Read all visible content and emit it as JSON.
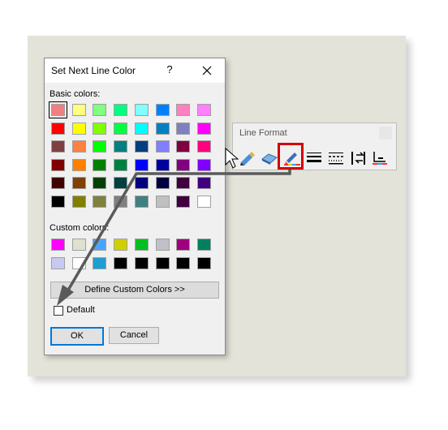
{
  "dialog": {
    "title": "Set Next Line Color",
    "help_label": "?",
    "basic_colors_label": "Basic colors:",
    "custom_colors_label": "Custom colors:",
    "define_button_label": "Define Custom Colors >>",
    "default_checkbox_label": "Default",
    "default_checked": false,
    "ok_label": "OK",
    "cancel_label": "Cancel",
    "basic_colors": [
      [
        "#f08080",
        "#ffff80",
        "#80ff80",
        "#00ff80",
        "#80ffff",
        "#0080ff",
        "#ff80c0",
        "#ff80ff"
      ],
      [
        "#ff0000",
        "#ffff00",
        "#80ff00",
        "#00ff40",
        "#00ffff",
        "#0080c0",
        "#8080c0",
        "#ff00ff"
      ],
      [
        "#804040",
        "#ff8040",
        "#00ff00",
        "#008080",
        "#004080",
        "#8080ff",
        "#800040",
        "#ff0080"
      ],
      [
        "#800000",
        "#ff8000",
        "#008000",
        "#008040",
        "#0000ff",
        "#0000a0",
        "#800080",
        "#8000ff"
      ],
      [
        "#400000",
        "#804000",
        "#004000",
        "#004040",
        "#000080",
        "#000040",
        "#400040",
        "#400080"
      ],
      [
        "#000000",
        "#808000",
        "#808040",
        "#808080",
        "#408080",
        "#c0c0c0",
        "#400040",
        "#ffffff"
      ]
    ],
    "custom_colors": [
      [
        "#ff00ff",
        "#e0e0d0",
        "#4aa3ff",
        "#d0d000",
        "#00c020",
        "#c0c0c8",
        "#a00080",
        "#008060"
      ],
      [
        "#c8c8f0",
        "#ffffff",
        "#1f9fcf",
        "#000000",
        "#000000",
        "#000000",
        "#000000",
        "#000000"
      ]
    ]
  },
  "toolbar": {
    "title": "Line Format",
    "icons": [
      "pen-icon",
      "eraser-icon",
      "line-color-icon",
      "line-weight-icon",
      "line-style-icon",
      "direction-icon",
      "offset-icon"
    ]
  }
}
